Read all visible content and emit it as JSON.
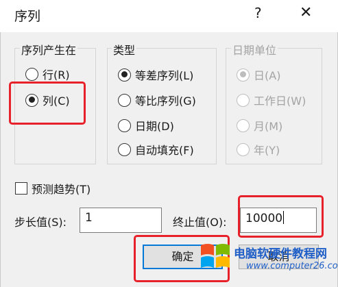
{
  "window": {
    "title": "序列",
    "help": "?",
    "close": "✕"
  },
  "series_in": {
    "label": "序列产生在",
    "options": [
      {
        "label": "行(R)",
        "checked": false
      },
      {
        "label": "列(C)",
        "checked": true
      }
    ]
  },
  "type": {
    "label": "类型",
    "options": [
      {
        "label": "等差序列(L)",
        "checked": true
      },
      {
        "label": "等比序列(G)",
        "checked": false
      },
      {
        "label": "日期(D)",
        "checked": false
      },
      {
        "label": "自动填充(F)",
        "checked": false
      }
    ]
  },
  "date_unit": {
    "label": "日期单位",
    "options": [
      {
        "label": "日(A)",
        "checked": true,
        "disabled": true
      },
      {
        "label": "工作日(W)",
        "checked": false,
        "disabled": true
      },
      {
        "label": "月(M)",
        "checked": false,
        "disabled": true
      },
      {
        "label": "年(Y)",
        "checked": false,
        "disabled": true
      }
    ]
  },
  "trend": {
    "label": "预测趋势(T)",
    "checked": false
  },
  "step": {
    "label": "步长值(S):",
    "value": "1"
  },
  "stop": {
    "label": "终止值(O):",
    "value": "10000"
  },
  "buttons": {
    "ok": "确定",
    "cancel": "取消"
  },
  "watermark": {
    "text": "电脑软硬件教程网",
    "url": "www.computer26.com",
    "colors": [
      "#f25022",
      "#7fba00",
      "#00a4ef",
      "#ffb900"
    ]
  },
  "colors": {
    "highlight": "#e8202a",
    "focus": "#0078d7"
  }
}
